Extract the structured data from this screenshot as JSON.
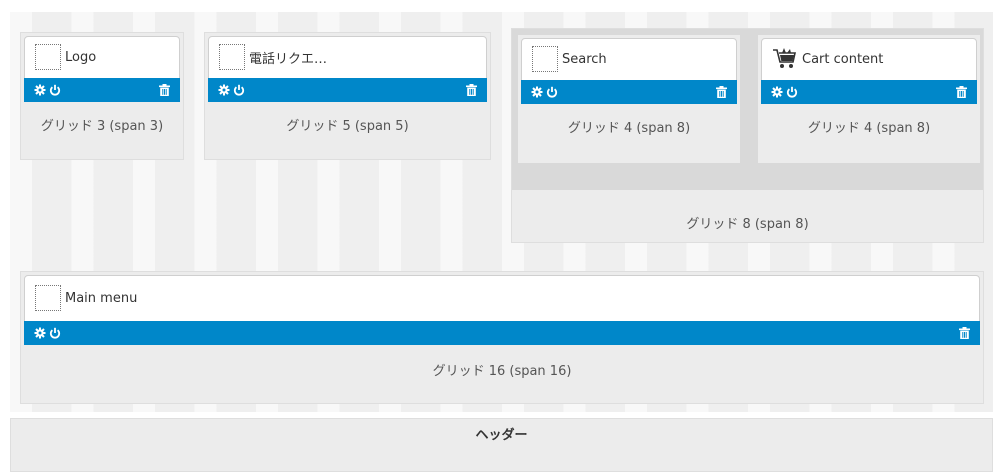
{
  "modules": {
    "logo": {
      "title": "Logo"
    },
    "request": {
      "title": "電話リクエ…"
    },
    "search": {
      "title": "Search"
    },
    "cart": {
      "title": "Cart content"
    },
    "main_menu": {
      "title": "Main menu"
    }
  },
  "grids": {
    "grid3": "グリッド 3 (span 3)",
    "grid5": "グリッド 5 (span 5)",
    "grid4a": "グリッド 4 (span 8)",
    "grid4b": "グリッド 4 (span 8)",
    "grid8": "グリッド 8 (span 8)",
    "grid16": "グリッド 16 (span 16)"
  },
  "section": {
    "label": "ヘッダー"
  },
  "colors": {
    "accent": "#0087c9",
    "grid_bg": "#ececec"
  },
  "icons": [
    "placeholder-icon",
    "gear-icon",
    "power-icon",
    "trash-icon",
    "cart-icon"
  ]
}
